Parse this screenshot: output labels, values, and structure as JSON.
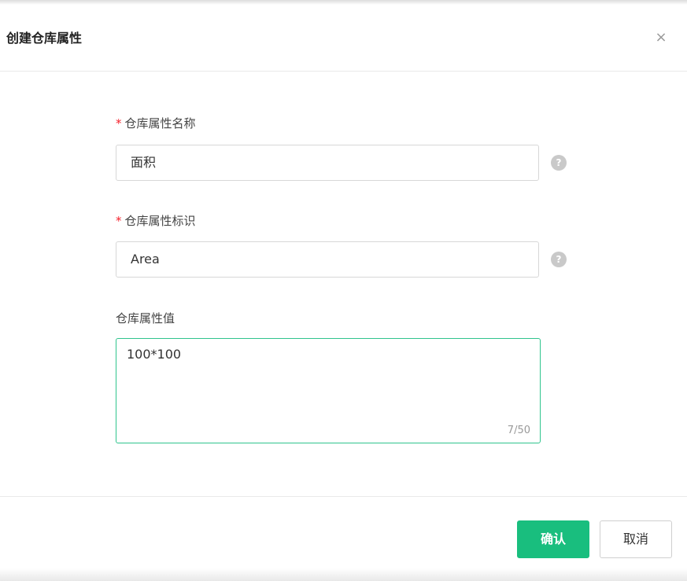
{
  "dialog": {
    "title": "创建仓库属性",
    "close_symbol": "×"
  },
  "form": {
    "name": {
      "label": "仓库属性名称",
      "required_mark": "*",
      "value": "面积",
      "help_symbol": "?"
    },
    "identifier": {
      "label": "仓库属性标识",
      "required_mark": "*",
      "value": "Area",
      "help_symbol": "?"
    },
    "value": {
      "label": "仓库属性值",
      "value": "100*100",
      "counter": "7/50"
    }
  },
  "footer": {
    "confirm_label": "确认",
    "cancel_label": "取消"
  },
  "colors": {
    "accent": "#19be7e",
    "focus_border": "#2fc48d",
    "required": "#f5222d"
  },
  "icons": {
    "close": "close-icon",
    "help": "help-circle-icon"
  }
}
